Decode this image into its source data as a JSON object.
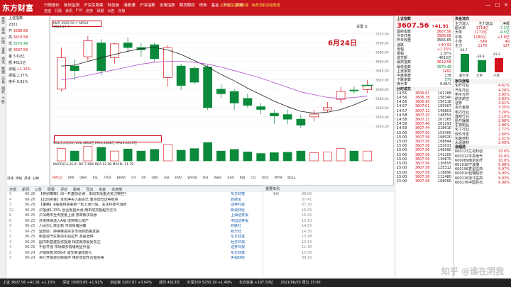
{
  "app": {
    "logo": "东方财富",
    "subtitle": "经典版",
    "menu": [
      "行情报价",
      "板块监测",
      "沪深京股票",
      "科创板",
      "港股通",
      "沪深指数",
      "全球指数",
      "期货期权",
      "债券",
      "基金",
      "外汇",
      "资讯"
    ],
    "menu2": [
      "自选",
      "行情",
      "资讯",
      "F10",
      "财务",
      "研报",
      "公告",
      "交易"
    ],
    "ad": "东方财富金融终端 · 免费领取深度数据",
    "window_controls": [
      "—",
      "□",
      "✕"
    ]
  },
  "sidebar": [
    "首页",
    "自选",
    "行情",
    "全景",
    "资讯",
    "数据",
    "交易",
    "期权",
    "个股"
  ],
  "pricecol": {
    "rows": [
      {
        "label": "上证指数",
        "value": "",
        "cls": ""
      },
      {
        "label": "2021",
        "value": "",
        "cls": ""
      },
      {
        "label": "开",
        "value": "3588.68",
        "cls": "red"
      },
      {
        "label": "高",
        "value": "3619.58",
        "cls": "red"
      },
      {
        "label": "低",
        "value": "3570.48",
        "cls": "green"
      },
      {
        "label": "收",
        "value": "3607.56",
        "cls": "red"
      },
      {
        "label": "量",
        "value": "3.62亿",
        "cls": ""
      },
      {
        "label": "额",
        "value": "4613亿",
        "cls": ""
      },
      {
        "label": "涨幅",
        "value": "+1.15%",
        "cls": "red"
      },
      {
        "label": "振幅",
        "value": "1.37%",
        "cls": ""
      },
      {
        "label": "换手",
        "value": "0.81%",
        "cls": ""
      }
    ],
    "period_tabs": [
      "日线",
      "周线",
      "月线",
      "分钟"
    ]
  },
  "chart": {
    "header": "MA5 MA10 MA20 MA30",
    "ma_box": "MA5 3562.50 ↑  MA10 3554.17 ↑",
    "annotation": "6月24日",
    "setting": "设置 ⇅",
    "vol_label": "VOL(5,10,20)  VOL:4813亿  MA5:4462亿  MA10:4315亿",
    "macd_label": "MACD(12,26,9)  DIF:7.084  DEA:12.98  MACD:-11.78"
  },
  "chart_data": {
    "type": "candlestick",
    "title": "上证指数 日线",
    "xlabel": "",
    "ylabel": "",
    "ylim": [
      3500,
      3730
    ],
    "candles": [
      {
        "o": 3600,
        "c": 3668,
        "h": 3690,
        "l": 3595,
        "up": true
      },
      {
        "o": 3650,
        "c": 3640,
        "h": 3665,
        "l": 3620,
        "up": false
      },
      {
        "o": 3670,
        "c": 3705,
        "h": 3715,
        "l": 3660,
        "up": true
      },
      {
        "o": 3700,
        "c": 3640,
        "h": 3708,
        "l": 3630,
        "up": false
      },
      {
        "o": 3668,
        "c": 3698,
        "h": 3700,
        "l": 3655,
        "up": true
      },
      {
        "o": 3700,
        "c": 3690,
        "h": 3712,
        "l": 3680,
        "up": false
      },
      {
        "o": 3690,
        "c": 3685,
        "h": 3700,
        "l": 3670,
        "up": false
      },
      {
        "o": 3696,
        "c": 3666,
        "h": 3700,
        "l": 3660,
        "up": false
      },
      {
        "o": 3625,
        "c": 3690,
        "h": 3695,
        "l": 3605,
        "up": true
      },
      {
        "o": 3650,
        "c": 3608,
        "h": 3655,
        "l": 3598,
        "up": false
      },
      {
        "o": 3645,
        "c": 3615,
        "h": 3650,
        "l": 3610,
        "up": false
      },
      {
        "o": 3648,
        "c": 3560,
        "h": 3652,
        "l": 3555,
        "up": false
      },
      {
        "o": 3600,
        "c": 3590,
        "h": 3610,
        "l": 3580,
        "up": false
      },
      {
        "o": 3595,
        "c": 3570,
        "h": 3600,
        "l": 3555,
        "up": false
      },
      {
        "o": 3580,
        "c": 3565,
        "h": 3590,
        "l": 3560,
        "up": false
      },
      {
        "o": 3562,
        "c": 3556,
        "h": 3570,
        "l": 3546,
        "up": false
      },
      {
        "o": 3548,
        "c": 3542,
        "h": 3555,
        "l": 3525,
        "up": false
      },
      {
        "o": 3545,
        "c": 3535,
        "h": 3556,
        "l": 3524,
        "up": false
      },
      {
        "o": 3535,
        "c": 3522,
        "h": 3545,
        "l": 3515,
        "up": false
      },
      {
        "o": 3540,
        "c": 3546,
        "h": 3555,
        "l": 3530,
        "up": true
      },
      {
        "o": 3555,
        "c": 3560,
        "h": 3572,
        "l": 3550,
        "up": true
      },
      {
        "o": 3578,
        "c": 3595,
        "h": 3605,
        "l": 3570,
        "up": true
      },
      {
        "o": 3598,
        "c": 3596,
        "h": 3606,
        "l": 3590,
        "up": false
      },
      {
        "o": 3599,
        "c": 3608,
        "h": 3620,
        "l": 3592,
        "up": true
      }
    ],
    "ma": [
      3650,
      3652,
      3660,
      3668,
      3675,
      3682,
      3688,
      3690,
      3685,
      3675,
      3662,
      3648,
      3632,
      3618,
      3602,
      3588,
      3574,
      3562,
      3552,
      3548,
      3550,
      3556,
      3566,
      3578
    ],
    "ma2": [
      3620,
      3624,
      3630,
      3636,
      3642,
      3648,
      3654,
      3658,
      3660,
      3660,
      3658,
      3654,
      3648,
      3640,
      3632,
      3624,
      3614,
      3604,
      3594,
      3588,
      3582,
      3580,
      3582,
      3585
    ],
    "vol": [
      30,
      24,
      36,
      33,
      24,
      29,
      24,
      28,
      40,
      26,
      30,
      45,
      24,
      28,
      22,
      18,
      20,
      21,
      24,
      20,
      22,
      30,
      24,
      24
    ],
    "price_ticks": [
      "3720.00",
      "3700.00",
      "3680.00",
      "3660.00",
      "3640.00",
      "3620.00",
      "3600.00",
      "3580.00",
      "3560.00",
      "3540.00",
      "3520.00"
    ]
  },
  "indicators": [
    "MACD",
    "DMI",
    "DMA",
    "FSL",
    "TRIX",
    "BRAR",
    "CR",
    "VR",
    "OBV",
    "ASI",
    "EMV",
    "WVAD",
    "RSI",
    "W&R",
    "SAR",
    "KDJ",
    "CCI",
    "ROC",
    "MTM",
    "BOLL"
  ],
  "news": {
    "tabs": [
      "全部",
      "新闻",
      "公告",
      "研报",
      "评论",
      "股吧",
      "互动",
      "资金",
      "龙虎榜"
    ],
    "rows": [
      {
        "c1": "5",
        "c2": "06-26",
        "c3": "【特别推荐】周一开盘前必读：本周市场重点关注哪些？",
        "c4": "东方财富",
        "c5": "9月",
        "c6": "08:00"
      },
      {
        "c1": "4",
        "c2": "06-26",
        "c3": "【北向资金】本周净买入超百亿 重点加仓这些板块",
        "c4": "数据宝",
        "c5": "",
        "c6": "07:41"
      },
      {
        "c1": "3",
        "c2": "06-26",
        "c3": "【策略】A股或将迎来新一轮上涨行情，关注科技与消费",
        "c4": "证券时报",
        "c5": "",
        "c6": "07:20"
      },
      {
        "c1": "12",
        "c2": "06-25",
        "c3": "沪指涨1.15% 创业板指大涨 两市成交额超万亿元",
        "c4": "新浪财经",
        "c5": "",
        "c6": "16:05"
      },
      {
        "c1": "8",
        "c2": "06-25",
        "c3": "沪深两市全天放量上涨 券商板块领涨",
        "c4": "上海证券报",
        "c5": "",
        "c6": "15:42"
      },
      {
        "c1": "6",
        "c2": "06-25",
        "c3": "外资持续流入A股 增持核心资产",
        "c4": "中国证券报",
        "c5": "",
        "c6": "15:10"
      },
      {
        "c1": "9",
        "c2": "06-25",
        "c3": "人民币汇率企稳 市场情绪回暖",
        "c4": "财联社",
        "c5": "",
        "c6": "14:55"
      },
      {
        "c1": "7",
        "c2": "06-25",
        "c3": "监管层：持续推进资本市场高质量发展",
        "c4": "新华社",
        "c5": "",
        "c6": "14:30"
      },
      {
        "c1": "5",
        "c2": "06-25",
        "c3": "新能源汽车板块午后拉升 多股涨停",
        "c4": "东方财富",
        "c5": "",
        "c6": "13:48"
      },
      {
        "c1": "4",
        "c2": "06-25",
        "c3": "国内新基建投资提速 相关概念股受关注",
        "c4": "经济日报",
        "c5": "",
        "c6": "12:10"
      },
      {
        "c1": "3",
        "c2": "06-25",
        "c3": "千股齐涨 市场做多情绪明显升温",
        "c4": "证券日报",
        "c5": "",
        "c6": "11:30"
      },
      {
        "c1": "2",
        "c2": "06-24",
        "c3": "沪指收复3600点 成交量温和放大",
        "c4": "东方财富",
        "c5": "",
        "c6": "15:30"
      },
      {
        "c1": "1",
        "c2": "06-24",
        "c3": "央行开展逆回购操作 维护流动性合理充裕",
        "c4": "央视财经",
        "c5": "",
        "c6": "09:20"
      }
    ],
    "right_title": "重要资讯"
  },
  "quote": {
    "title": "上证指数",
    "price": "3607.56",
    "change": "+41.91",
    "rows": [
      {
        "k": "最新指数",
        "v": "3607.56",
        "cls": "red"
      },
      {
        "k": "今日开盘",
        "v": "3588.68",
        "cls": "red"
      },
      {
        "k": "昨日收盘",
        "v": "3566.65",
        "cls": ""
      },
      {
        "k": "涨跌",
        "v": "+40.91",
        "cls": "red"
      },
      {
        "k": "涨幅",
        "v": "+1.15%",
        "cls": "red"
      },
      {
        "k": "振幅",
        "v": "1.37%",
        "cls": ""
      },
      {
        "k": "成交额",
        "v": "4613亿",
        "cls": ""
      },
      {
        "k": "最高指数",
        "v": "3619.58",
        "cls": "red"
      },
      {
        "k": "最低指数",
        "v": "3570.48",
        "cls": "green"
      },
      {
        "k": "上涨家数",
        "v": "1492",
        "cls": "red"
      },
      {
        "k": "平盘家数",
        "v": "178",
        "cls": ""
      },
      {
        "k": "下跌家数",
        "v": "379",
        "cls": "green"
      },
      {
        "k": "换手率",
        "v": "0.81%",
        "cls": ""
      }
    ],
    "ticks_header": "分时成交",
    "ticks": [
      {
        "t": "14:55",
        "p": "3606.61",
        "v": "161188"
      },
      {
        "t": "14:56",
        "p": "3606.78",
        "v": "158340"
      },
      {
        "t": "14:56",
        "p": "3606.95",
        "v": "150118"
      },
      {
        "t": "14:57",
        "p": "3607.01",
        "v": "155907"
      },
      {
        "t": "14:57",
        "p": "3607.12",
        "v": "149803"
      },
      {
        "t": "14:58",
        "p": "3607.20",
        "v": "148554"
      },
      {
        "t": "14:58",
        "p": "3607.31",
        "v": "207265"
      },
      {
        "t": "14:59",
        "p": "3607.40",
        "v": "201293"
      },
      {
        "t": "14:59",
        "p": "3607.44",
        "v": "218610"
      },
      {
        "t": "15:00",
        "p": "3607.50",
        "v": "153400"
      },
      {
        "t": "15:00",
        "p": "3607.56",
        "v": "198020"
      },
      {
        "t": "15:00",
        "p": "3607.56",
        "v": "168844"
      },
      {
        "t": "15:00",
        "p": "3607.56",
        "v": "152031"
      },
      {
        "t": "15:00",
        "p": "3607.56",
        "v": "146990"
      },
      {
        "t": "15:00",
        "p": "3607.56",
        "v": "141200"
      },
      {
        "t": "15:00",
        "p": "3607.56",
        "v": "139870"
      },
      {
        "t": "15:00",
        "p": "3607.56",
        "v": "130655"
      },
      {
        "t": "15:00",
        "p": "3607.56",
        "v": "125312"
      },
      {
        "t": "15:00",
        "p": "3607.56",
        "v": "118890"
      },
      {
        "t": "15:00",
        "p": "3607.56",
        "v": "112480"
      },
      {
        "t": "15:00",
        "p": "3607.56",
        "v": "108000"
      }
    ]
  },
  "fund": {
    "title": "资金流向",
    "header": [
      "主力流入",
      "主力流出",
      "净额"
    ],
    "rows": [
      {
        "k": "超大单",
        "a": "1719亿",
        "b": "-7.1亿"
      },
      {
        "k": "大单",
        "a": "1171亿",
        "b": "-4.5亿"
      },
      {
        "k": "中单",
        "a": "1180亿",
        "b": "+1.8亿"
      },
      {
        "k": "小单",
        "a": "549",
        "b": "49"
      },
      {
        "k": "主力",
        "a": "1170",
        "b": "127"
      }
    ],
    "bar_labels": [
      "-56.7",
      "-36.8",
      "43.2"
    ],
    "bar_values": [
      -56.7,
      -36.8,
      43.2
    ],
    "bar_names": [
      "超大单",
      "大单",
      "小单"
    ],
    "sectors_title": "板块涨幅",
    "sectors": [
      {
        "k": "化纤行业",
        "v": "4.61%"
      },
      {
        "k": "汽车行业",
        "v": "4.28%"
      },
      {
        "k": "电子元件",
        "v": "3.95%"
      },
      {
        "k": "航天航空",
        "v": "3.83%"
      },
      {
        "k": "证券",
        "v": "3.61%"
      },
      {
        "k": "多元金融",
        "v": "3.55%"
      },
      {
        "k": "电力行业",
        "v": "3.20%"
      },
      {
        "k": "煤炭行业",
        "v": "3.10%"
      },
      {
        "k": "医疗器械",
        "v": "2.98%"
      },
      {
        "k": "生物制品",
        "v": "2.86%"
      },
      {
        "k": "化工行业",
        "v": "2.71%"
      },
      {
        "k": "软件开发",
        "v": "2.60%"
      },
      {
        "k": "包装材料",
        "v": "2.51%"
      },
      {
        "k": "水泥建材",
        "v": "2.40%"
      }
    ],
    "stocks_title": "涨幅榜",
    "stocks": [
      {
        "k": "600123兰花科创",
        "v": "10.0%"
      },
      {
        "k": "600312平高电气",
        "v": "10.0%"
      },
      {
        "k": "600089南京化纤",
        "v": "10.0%"
      },
      {
        "k": "601018宁波港",
        "v": "9.98%"
      },
      {
        "k": "600196复星医药",
        "v": "9.97%"
      },
      {
        "k": "600010包钢股份",
        "v": "9.95%"
      },
      {
        "k": "600216浙江医药",
        "v": "9.93%"
      },
      {
        "k": "600176中国巨石",
        "v": "9.90%"
      }
    ]
  },
  "status": {
    "items": [
      "上证 3607.56 +41.91 +1.15%",
      "深证 15083.85 +1.91%",
      "创业板 3287.87 +3.04%",
      "成交 4613亿",
      "沪深300 5230.19 +1.49%",
      "北向资金 +107.53亿",
      "2021/06/25 周五 15:00"
    ]
  },
  "watermark": "知乎 @谁在阴我"
}
